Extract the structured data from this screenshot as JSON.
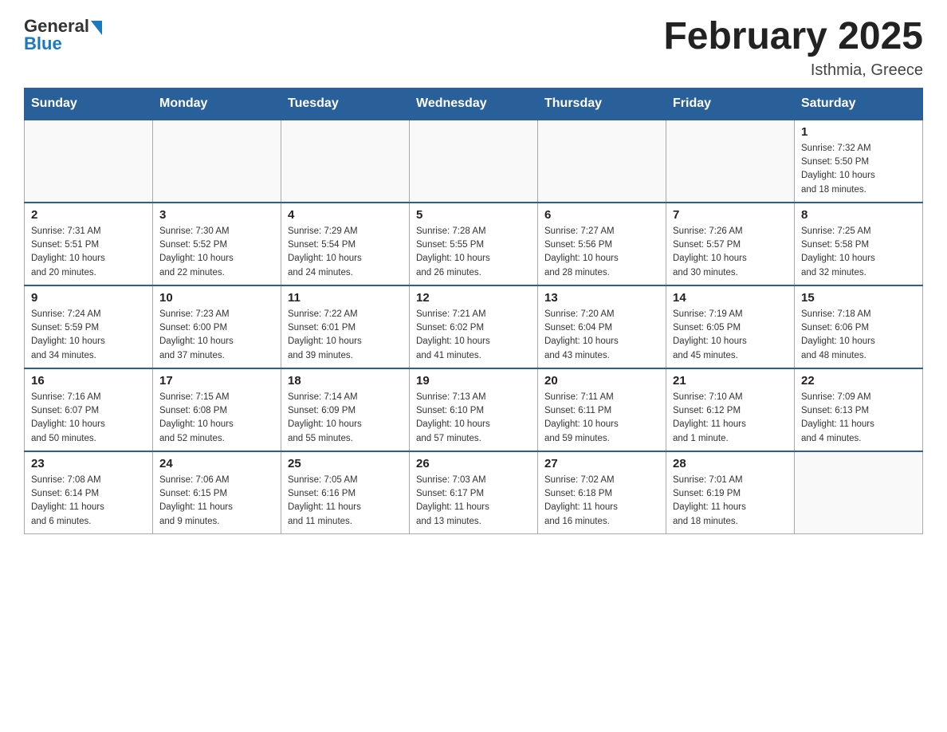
{
  "header": {
    "logo_general": "General",
    "logo_blue": "Blue",
    "month_title": "February 2025",
    "location": "Isthmia, Greece"
  },
  "weekdays": [
    "Sunday",
    "Monday",
    "Tuesday",
    "Wednesday",
    "Thursday",
    "Friday",
    "Saturday"
  ],
  "weeks": [
    [
      {
        "day": "",
        "info": ""
      },
      {
        "day": "",
        "info": ""
      },
      {
        "day": "",
        "info": ""
      },
      {
        "day": "",
        "info": ""
      },
      {
        "day": "",
        "info": ""
      },
      {
        "day": "",
        "info": ""
      },
      {
        "day": "1",
        "info": "Sunrise: 7:32 AM\nSunset: 5:50 PM\nDaylight: 10 hours\nand 18 minutes."
      }
    ],
    [
      {
        "day": "2",
        "info": "Sunrise: 7:31 AM\nSunset: 5:51 PM\nDaylight: 10 hours\nand 20 minutes."
      },
      {
        "day": "3",
        "info": "Sunrise: 7:30 AM\nSunset: 5:52 PM\nDaylight: 10 hours\nand 22 minutes."
      },
      {
        "day": "4",
        "info": "Sunrise: 7:29 AM\nSunset: 5:54 PM\nDaylight: 10 hours\nand 24 minutes."
      },
      {
        "day": "5",
        "info": "Sunrise: 7:28 AM\nSunset: 5:55 PM\nDaylight: 10 hours\nand 26 minutes."
      },
      {
        "day": "6",
        "info": "Sunrise: 7:27 AM\nSunset: 5:56 PM\nDaylight: 10 hours\nand 28 minutes."
      },
      {
        "day": "7",
        "info": "Sunrise: 7:26 AM\nSunset: 5:57 PM\nDaylight: 10 hours\nand 30 minutes."
      },
      {
        "day": "8",
        "info": "Sunrise: 7:25 AM\nSunset: 5:58 PM\nDaylight: 10 hours\nand 32 minutes."
      }
    ],
    [
      {
        "day": "9",
        "info": "Sunrise: 7:24 AM\nSunset: 5:59 PM\nDaylight: 10 hours\nand 34 minutes."
      },
      {
        "day": "10",
        "info": "Sunrise: 7:23 AM\nSunset: 6:00 PM\nDaylight: 10 hours\nand 37 minutes."
      },
      {
        "day": "11",
        "info": "Sunrise: 7:22 AM\nSunset: 6:01 PM\nDaylight: 10 hours\nand 39 minutes."
      },
      {
        "day": "12",
        "info": "Sunrise: 7:21 AM\nSunset: 6:02 PM\nDaylight: 10 hours\nand 41 minutes."
      },
      {
        "day": "13",
        "info": "Sunrise: 7:20 AM\nSunset: 6:04 PM\nDaylight: 10 hours\nand 43 minutes."
      },
      {
        "day": "14",
        "info": "Sunrise: 7:19 AM\nSunset: 6:05 PM\nDaylight: 10 hours\nand 45 minutes."
      },
      {
        "day": "15",
        "info": "Sunrise: 7:18 AM\nSunset: 6:06 PM\nDaylight: 10 hours\nand 48 minutes."
      }
    ],
    [
      {
        "day": "16",
        "info": "Sunrise: 7:16 AM\nSunset: 6:07 PM\nDaylight: 10 hours\nand 50 minutes."
      },
      {
        "day": "17",
        "info": "Sunrise: 7:15 AM\nSunset: 6:08 PM\nDaylight: 10 hours\nand 52 minutes."
      },
      {
        "day": "18",
        "info": "Sunrise: 7:14 AM\nSunset: 6:09 PM\nDaylight: 10 hours\nand 55 minutes."
      },
      {
        "day": "19",
        "info": "Sunrise: 7:13 AM\nSunset: 6:10 PM\nDaylight: 10 hours\nand 57 minutes."
      },
      {
        "day": "20",
        "info": "Sunrise: 7:11 AM\nSunset: 6:11 PM\nDaylight: 10 hours\nand 59 minutes."
      },
      {
        "day": "21",
        "info": "Sunrise: 7:10 AM\nSunset: 6:12 PM\nDaylight: 11 hours\nand 1 minute."
      },
      {
        "day": "22",
        "info": "Sunrise: 7:09 AM\nSunset: 6:13 PM\nDaylight: 11 hours\nand 4 minutes."
      }
    ],
    [
      {
        "day": "23",
        "info": "Sunrise: 7:08 AM\nSunset: 6:14 PM\nDaylight: 11 hours\nand 6 minutes."
      },
      {
        "day": "24",
        "info": "Sunrise: 7:06 AM\nSunset: 6:15 PM\nDaylight: 11 hours\nand 9 minutes."
      },
      {
        "day": "25",
        "info": "Sunrise: 7:05 AM\nSunset: 6:16 PM\nDaylight: 11 hours\nand 11 minutes."
      },
      {
        "day": "26",
        "info": "Sunrise: 7:03 AM\nSunset: 6:17 PM\nDaylight: 11 hours\nand 13 minutes."
      },
      {
        "day": "27",
        "info": "Sunrise: 7:02 AM\nSunset: 6:18 PM\nDaylight: 11 hours\nand 16 minutes."
      },
      {
        "day": "28",
        "info": "Sunrise: 7:01 AM\nSunset: 6:19 PM\nDaylight: 11 hours\nand 18 minutes."
      },
      {
        "day": "",
        "info": ""
      }
    ]
  ]
}
